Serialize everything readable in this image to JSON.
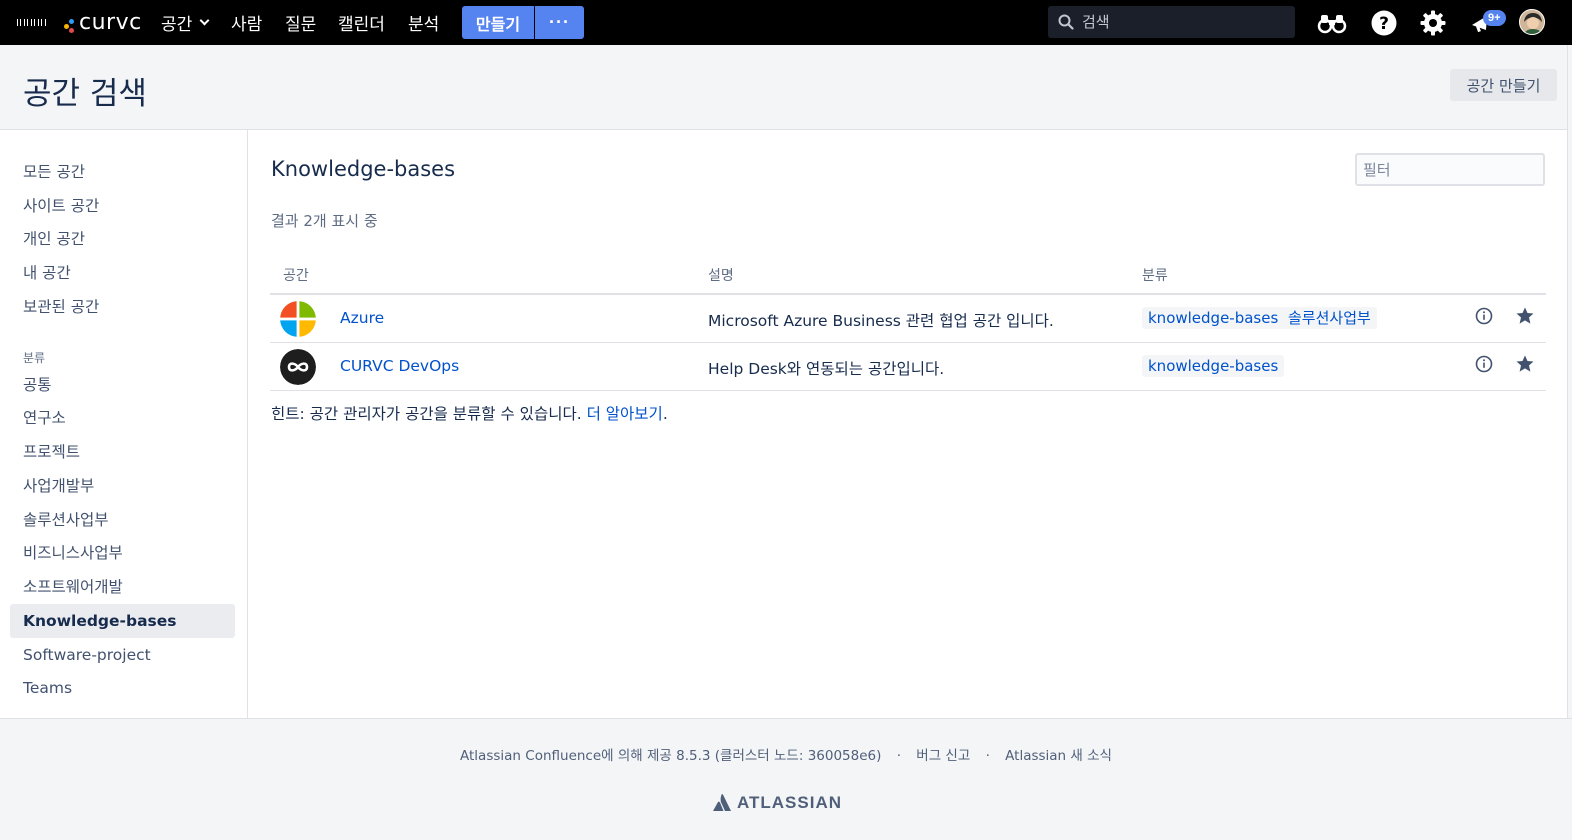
{
  "topnav": {
    "logo_text": "curvc",
    "links": [
      "공간",
      "사람",
      "질문",
      "캘린더",
      "분석"
    ],
    "create_label": "만들기",
    "more_label": "···",
    "search_placeholder": "검색",
    "notification_badge": "9+",
    "icons": [
      "app-switcher-icon",
      "binoculars-icon",
      "help-icon",
      "settings-icon",
      "notifications-icon",
      "avatar"
    ]
  },
  "header": {
    "title": "공간 검색",
    "create_space_label": "공간 만들기"
  },
  "sidebar": {
    "items": [
      "모든 공간",
      "사이트 공간",
      "개인 공간",
      "내 공간",
      "보관된 공간"
    ],
    "category_label": "분류",
    "categories": [
      "공통",
      "연구소",
      "프로젝트",
      "사업개발부",
      "솔루션사업부",
      "비즈니스사업부",
      "소프트웨어개발",
      "Knowledge-bases",
      "Software-project",
      "Teams"
    ],
    "active_category": "Knowledge-bases"
  },
  "main": {
    "title": "Knowledge-bases",
    "filter_placeholder": "필터",
    "result_count": "결과 2개 표시 중",
    "columns": [
      "공간",
      "설명",
      "분류"
    ],
    "rows": [
      {
        "name": "Azure",
        "description": "Microsoft Azure Business 관련 협업 공간 입니다.",
        "labels": [
          "knowledge-bases",
          "솔루션사업부"
        ],
        "logo": "windows-logo-icon"
      },
      {
        "name": "CURVC DevOps",
        "description": "Help Desk와 연동되는 공간입니다.",
        "labels": [
          "knowledge-bases"
        ],
        "logo": "infinity-logo-icon"
      }
    ],
    "hint_text": "힌트: 공간 관리자가 공간을 분류할 수 있습니다.",
    "hint_link": "더 알아보기",
    "hint_end": "."
  },
  "footer": {
    "powered_by": "Atlassian Confluence에 의해 제공 8.5.3 (클러스터 노드: 360058e6)",
    "separator": "·",
    "bug_report": "버그 신고",
    "news": "Atlassian 새 소식",
    "brand": "ATLASSIAN"
  },
  "colors": {
    "accent": "#5584f0",
    "link": "#0052cc",
    "topbar": "#000000"
  }
}
